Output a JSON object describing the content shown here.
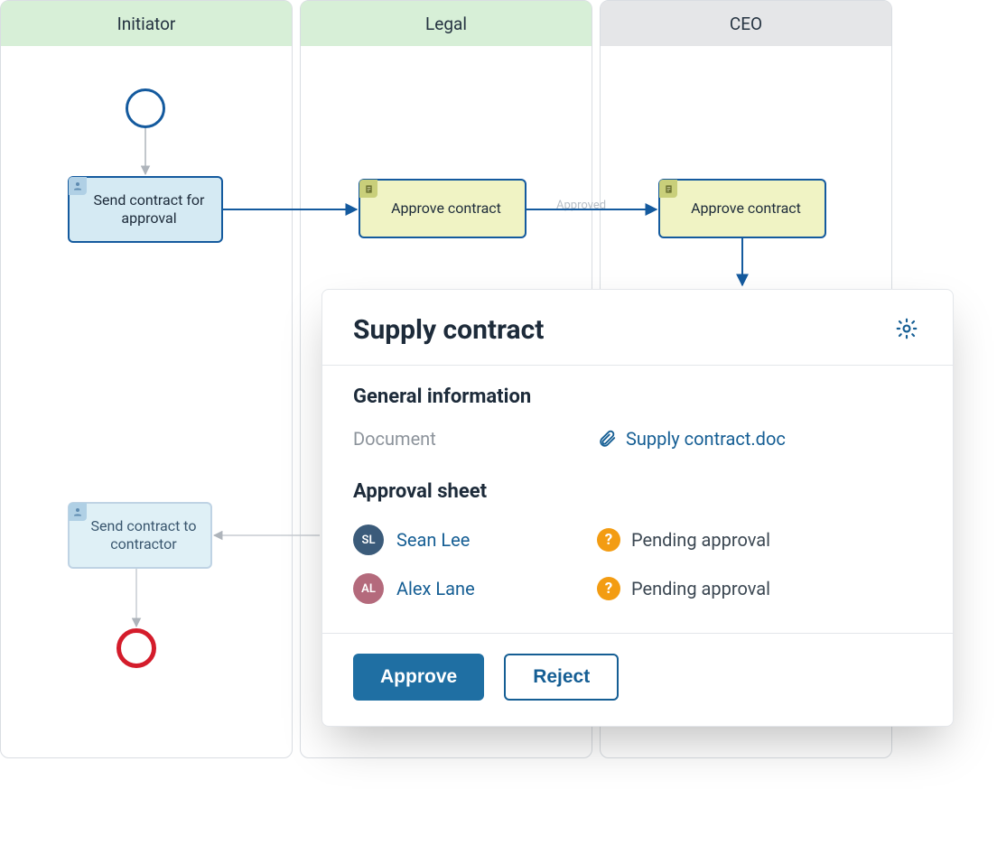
{
  "lanes": {
    "initiator": {
      "title": "Initiator",
      "active": true
    },
    "legal": {
      "title": "Legal",
      "active": true
    },
    "ceo": {
      "title": "CEO",
      "active": false
    }
  },
  "tasks": {
    "send_for_approval": "Send contract for approval",
    "approve_legal": "Approve contract",
    "approve_ceo": "Approve contract",
    "send_to_contractor": "Send contract to contractor"
  },
  "flow_labels": {
    "legal_to_ceo": "Approved"
  },
  "card": {
    "title": "Supply contract",
    "sections": {
      "general": "General information",
      "document_label": "Document",
      "document_name": "Supply contract.doc",
      "approval": "Approval sheet"
    },
    "approvers": [
      {
        "name": "Sean Lee",
        "initials": "SL",
        "avatar_bg": "#3b5b7a",
        "status": "Pending approval"
      },
      {
        "name": "Alex Lane",
        "initials": "AL",
        "avatar_bg": "#b46a7c",
        "status": "Pending approval"
      }
    ],
    "buttons": {
      "approve": "Approve",
      "reject": "Reject"
    }
  },
  "icons": {
    "user": "person-icon",
    "doc": "document-icon",
    "gear": "gear-icon",
    "clip": "paperclip-icon",
    "pending": "question-icon"
  }
}
